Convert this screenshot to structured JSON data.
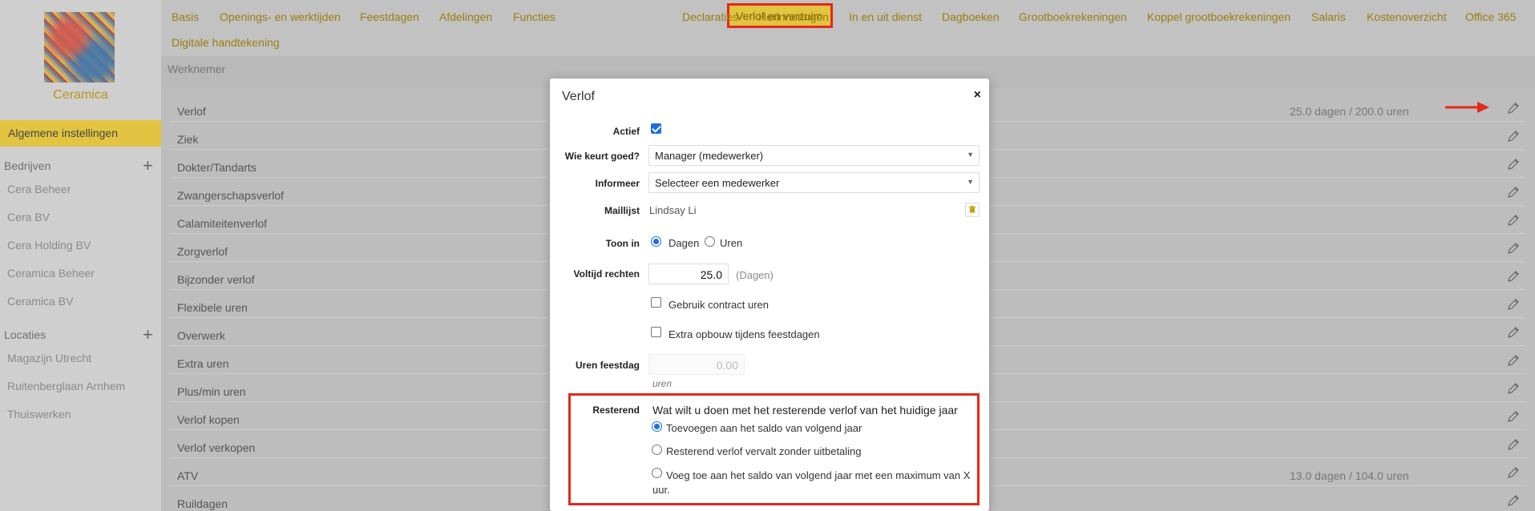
{
  "company": {
    "name": "Ceramica"
  },
  "sidebar": {
    "active_item": "Algemene instellingen",
    "companies_header": "Bedrijven",
    "companies": [
      "Cera Beheer",
      "Cera BV",
      "Cera Holding BV",
      "Ceramica Beheer",
      "Ceramica BV"
    ],
    "locations_header": "Locaties",
    "locations": [
      "Magazijn Utrecht",
      "Ruitenberglaan Arnhem",
      "Thuiswerken"
    ]
  },
  "tabs": [
    "Basis",
    "Openings- en werktijden",
    "Feestdagen",
    "Afdelingen",
    "Functies",
    "Verlof en verzuim",
    "Declaraties",
    "Herinneringen",
    "In en uit dienst",
    "Dagboeken",
    "Grootboekrekeningen",
    "Koppel grootboekrekeningen",
    "Salaris",
    "Kostenoverzicht",
    "Office 365",
    "Digitale handtekening"
  ],
  "active_tab": "Verlof en verzuim",
  "section_title": "Werknemer",
  "leave_types": [
    {
      "label": "Verlof",
      "value": "25.0 dagen / 200.0 uren"
    },
    {
      "label": "Ziek",
      "value": ""
    },
    {
      "label": "Dokter/Tandarts",
      "value": ""
    },
    {
      "label": "Zwangerschapsverlof",
      "value": ""
    },
    {
      "label": "Calamiteitenverlof",
      "value": ""
    },
    {
      "label": "Zorgverlof",
      "value": ""
    },
    {
      "label": "Bijzonder verlof",
      "value": ""
    },
    {
      "label": "Flexibele uren",
      "value": ""
    },
    {
      "label": "Overwerk",
      "value": ""
    },
    {
      "label": "Extra uren",
      "value": ""
    },
    {
      "label": "Plus/min uren",
      "value": ""
    },
    {
      "label": "Verlof kopen",
      "value": ""
    },
    {
      "label": "Verlof verkopen",
      "value": ""
    },
    {
      "label": "ATV",
      "value": "13.0 dagen / 104.0 uren"
    },
    {
      "label": "Ruildagen",
      "value": ""
    }
  ],
  "modal": {
    "title": "Verlof",
    "close_symbol": "×",
    "actief_label": "Actief",
    "actief_checked": true,
    "approver_label": "Wie keurt goed?",
    "approver_value": "Manager (medewerker)",
    "inform_label": "Informeer",
    "inform_value": "Selecteer een medewerker",
    "maillist_label": "Maillijst",
    "maillist_value": "Lindsay Li",
    "show_in_label": "Toon in",
    "show_in_options": [
      "Dagen",
      "Uren"
    ],
    "show_in_selected": "Dagen",
    "fulltime_label": "Voltijd rechten",
    "fulltime_value": "25.0",
    "fulltime_unit": "(Dagen)",
    "use_contract_label": "Gebruik contract uren",
    "use_contract_checked": false,
    "extra_accrual_label": "Extra opbouw tijdens feestdagen",
    "extra_accrual_checked": false,
    "holiday_hours_label": "Uren feestdag",
    "holiday_hours_value": "0.00",
    "holiday_hours_unit": "uren",
    "remaining_label": "Resterend",
    "remaining_question": "Wat wilt u doen met het resterende verlof van het huidige jaar",
    "remaining_options": [
      "Toevoegen aan het saldo van volgend jaar",
      "Resterend verlof vervalt zonder uitbetaling",
      "Voeg toe aan het saldo van volgend jaar met een maximum van X uur."
    ],
    "remaining_selected": 0
  },
  "colors": {
    "accent": "#e2c442",
    "nav_text": "#9a7e10",
    "highlight": "#e5281a",
    "checkbox": "#1d6fe0"
  }
}
